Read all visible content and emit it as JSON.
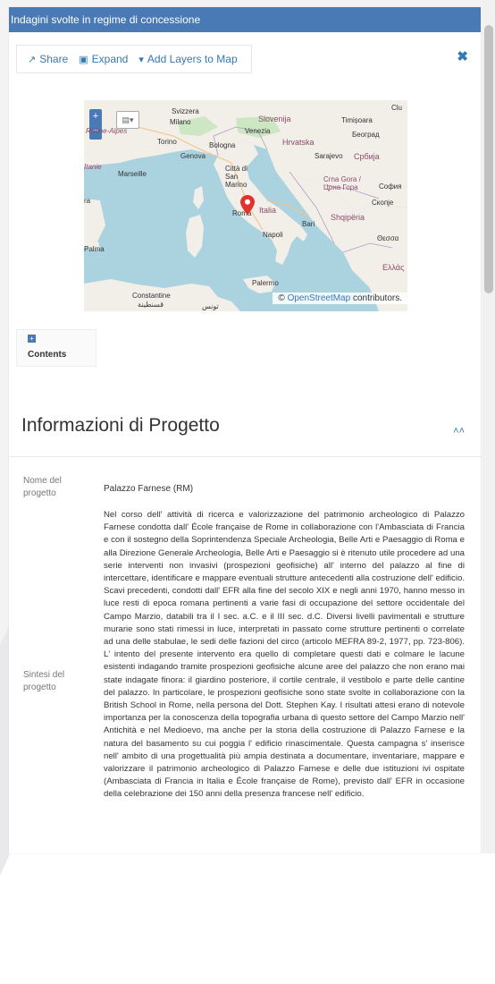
{
  "window": {
    "title": "Indagini svolte in regime di concessione"
  },
  "toolbar": {
    "share_label": "Share",
    "expand_label": "Expand",
    "add_layers_label": "Add Layers to Map"
  },
  "map": {
    "labels": {
      "svizzera": "Svizzera",
      "milano": "Milano",
      "venezia": "Venezia",
      "slovenija": "Slovenija",
      "timisoara": "Timișoara",
      "beograd": "Београд",
      "torino": "Torino",
      "bologna": "Bologna",
      "hrvatska": "Hrvatska",
      "sarajevo": "Sarajevo",
      "srbija": "Србија",
      "genova": "Genova",
      "rhone_alpes": "Rhône-Alpes",
      "citta_san_marino": "Città di San Marino",
      "marseille": "Marseille",
      "crna_gora": "Crna Gora / Црна Гора",
      "sofia": "София",
      "skopje": "Скопје",
      "roma": "Roma",
      "italia": "Italia",
      "shqiperia": "Shqipëria",
      "bari": "Bari",
      "napoli": "Napoli",
      "palma": "Palma",
      "thessaloniki": "Θεσσα",
      "ellada": "Ελλάς",
      "palermo": "Palermo",
      "constantine": "Constantine",
      "constantine_ar": "قسنطينة",
      "tunis": "تونس",
      "italie": "Itanie",
      "cluj": "Clu",
      "ra": "ra"
    },
    "attribution_prefix": "© ",
    "attribution_link": "OpenStreetMap",
    "attribution_suffix": " contributors."
  },
  "contents": {
    "label": "Contents"
  },
  "section": {
    "title": "Informazioni di Progetto",
    "fields": [
      {
        "label": "Nome del progetto",
        "value": "Palazzo Farnese (RM)"
      },
      {
        "label": "Sintesi del progetto",
        "value": "Nel corso dell' attività di ricerca e valorizzazione del patrimonio archeologico di Palazzo Farnese condotta dall' École française de Rome in collaborazione con l'Ambasciata di Francia e con il sostegno della Soprintendenza Speciale Archeologia, Belle Arti e Paesaggio di Roma e alla Direzione Generale Archeologia, Belle Arti e Paesaggio si è ritenuto utile procedere ad una serie interventi non invasivi (prospezioni geofisiche) all' interno del palazzo al fine di intercettare, identificare e mappare eventuali strutture antecedenti alla costruzione dell' edificio. Scavi precedenti, condotti dall' EFR alla fine del secolo XIX e negli anni 1970, hanno messo in luce resti di epoca romana pertinenti a varie fasi di occupazione del settore occidentale del Campo Marzio, databili tra il I sec. a.C. e il III sec. d.C. Diversi livelli pavimentali e strutture murarie sono stati rimessi in luce, interpretati in passato come strutture pertinenti o correlate ad una delle stabulae, le sedi delle fazioni del circo (articolo MEFRA 89-2, 1977, pp. 723-806). L' intento del presente intervento era quello di completare questi dati e colmare le lacune esistenti indagando tramite prospezioni geofisiche alcune aree del palazzo che non erano mai state indagate finora: il giardino posteriore, il cortile centrale, il vestibolo e parte delle cantine del palazzo. In particolare, le prospezioni geofisiche sono state svolte in collaborazione con la British School in Rome, nella persona del Dott. Stephen Kay. I risultati attesi erano di notevole importanza per la conoscenza della topografia urbana di questo settore del Campo Marzio nell' Antichità e nel Medioevo, ma anche per la storia della costruzione di Palazzo Farnese e la natura del basamento su cui poggia l' edificio rinascimentale. Questa campagna s' inserisce nell' ambito di una progettualità più ampia destinata a documentare, inventariare, mappare e valorizzare il patrimonio archeologico di Palazzo Farnese e delle due istituzioni ivi ospitate (Ambasciata di Francia in Italia e École française de Rome), previsto dall' EFR in occasione della celebrazione dei 150 anni della presenza francese nell' edificio."
      }
    ]
  },
  "colors": {
    "accent": "#4a7ab5",
    "link": "#337ab7",
    "sea": "#aad3df",
    "land": "#f2efe9",
    "marker": "#e0332f"
  }
}
